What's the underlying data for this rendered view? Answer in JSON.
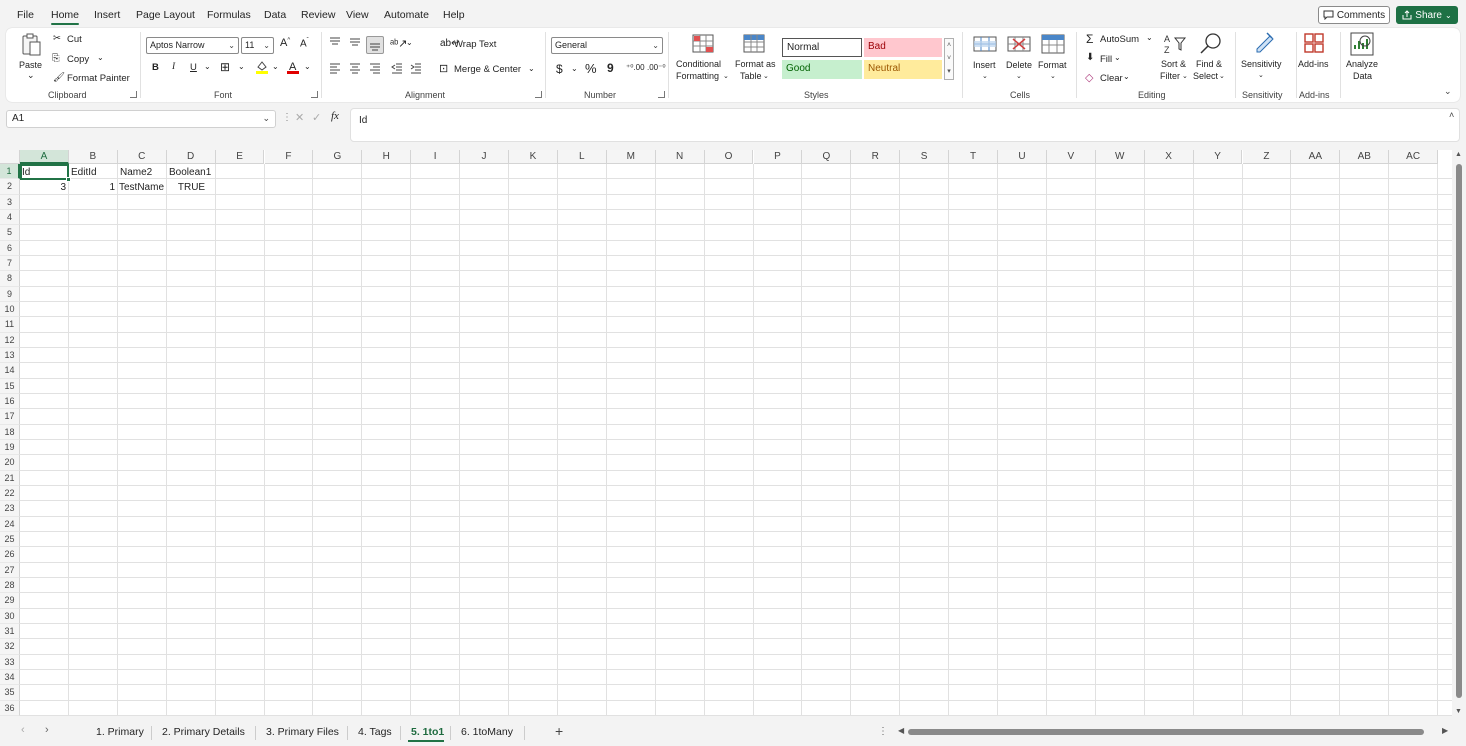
{
  "menu": {
    "tabs": [
      {
        "label": "File"
      },
      {
        "label": "Home"
      },
      {
        "label": "Insert"
      },
      {
        "label": "Page Layout"
      },
      {
        "label": "Formulas"
      },
      {
        "label": "Data"
      },
      {
        "label": "Review"
      },
      {
        "label": "View"
      },
      {
        "label": "Automate"
      },
      {
        "label": "Help"
      }
    ],
    "comments_label": "Comments",
    "share_label": "Share"
  },
  "ribbon": {
    "clipboard": {
      "paste": "Paste",
      "cut": "Cut",
      "copy": "Copy",
      "format_painter": "Format Painter",
      "label": "Clipboard"
    },
    "font": {
      "font_name": "Aptos Narrow",
      "font_size": "11",
      "label": "Font"
    },
    "alignment": {
      "wrap_text": "Wrap Text",
      "merge_center": "Merge & Center",
      "label": "Alignment"
    },
    "number": {
      "format": "General",
      "currency": "$",
      "percent": "%",
      "comma": "9",
      "label": "Number"
    },
    "styles": {
      "conditional_formatting_1": "Conditional",
      "conditional_formatting_2": "Formatting",
      "format_as_table_1": "Format as",
      "format_as_table_2": "Table",
      "normal": "Normal",
      "bad": "Bad",
      "good": "Good",
      "neutral": "Neutral",
      "label": "Styles"
    },
    "cells": {
      "insert": "Insert",
      "delete": "Delete",
      "format": "Format",
      "label": "Cells"
    },
    "editing": {
      "autosum": "AutoSum",
      "fill": "Fill",
      "clear": "Clear",
      "sort_filter_1": "Sort &",
      "sort_filter_2": "Filter",
      "find_select_1": "Find &",
      "find_select_2": "Select",
      "label": "Editing"
    },
    "sensitivity": {
      "button": "Sensitivity",
      "label": "Sensitivity"
    },
    "addins": {
      "button": "Add-ins",
      "label": "Add-ins"
    },
    "analyze": {
      "line1": "Analyze",
      "line2": "Data"
    }
  },
  "formula_bar": {
    "name_box": "A1",
    "fx": "fx",
    "content": "Id"
  },
  "grid": {
    "columns": [
      "A",
      "B",
      "C",
      "D",
      "E",
      "F",
      "G",
      "H",
      "I",
      "J",
      "K",
      "L",
      "M",
      "N",
      "O",
      "P",
      "Q",
      "R",
      "S",
      "T",
      "U",
      "V",
      "W",
      "X",
      "Y",
      "Z",
      "AA",
      "AB",
      "AC"
    ],
    "rows": [
      "1",
      "2",
      "3",
      "4",
      "5",
      "6",
      "7",
      "8",
      "9",
      "10",
      "11",
      "12",
      "13",
      "14",
      "15",
      "16",
      "17",
      "18",
      "19",
      "20",
      "21",
      "22",
      "23",
      "24",
      "25",
      "26",
      "27",
      "28",
      "29",
      "30",
      "31",
      "32",
      "33",
      "34",
      "35",
      "36"
    ],
    "cells": {
      "A1": "Id",
      "B1": "EditId",
      "C1": "Name2",
      "D1": "Boolean1",
      "A2": "3",
      "B2": "1",
      "C2": "TestName",
      "D2": "TRUE"
    }
  },
  "sheets": {
    "tabs": [
      {
        "label": "1. Primary"
      },
      {
        "label": "2. Primary Details"
      },
      {
        "label": "3. Primary Files"
      },
      {
        "label": "4. Tags"
      },
      {
        "label": "5. 1to1"
      },
      {
        "label": "6. 1toMany"
      }
    ],
    "add": "+"
  },
  "colors": {
    "accent": "#217346",
    "bad_fill": "#ffc7ce",
    "bad_text": "#9c0006",
    "good_fill": "#c6efce",
    "good_text": "#006100",
    "neutral_fill": "#ffeb9c",
    "neutral_text": "#9c5700"
  }
}
